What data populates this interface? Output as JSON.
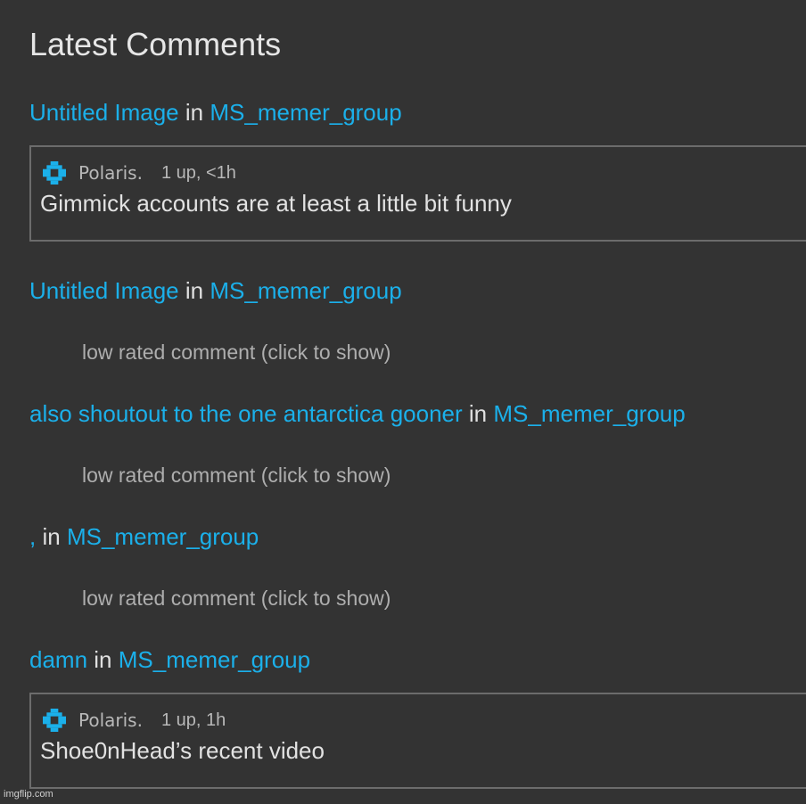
{
  "page": {
    "heading": "Latest Comments",
    "watermark": "imgflip.com"
  },
  "colors": {
    "background": "#333333",
    "link": "#1bb0ea",
    "icon": "#1bb0ea",
    "border": "#6c6c6c"
  },
  "comments": [
    {
      "post_title": "Untitled Image",
      "in_word": "in",
      "stream": "MS_memer_group",
      "username": "Polaris.",
      "meta": "1 up, <1h",
      "text": "Gimmick accounts are at least a little bit funny",
      "user_icon": "blue-pixel-cross-icon"
    },
    {
      "post_title": "Untitled Image",
      "in_word": "in",
      "stream": "MS_memer_group",
      "low_rated_text": "low rated comment (click to show)"
    },
    {
      "post_title": "also shoutout to the one antarctica gooner",
      "in_word": "in",
      "stream": "MS_memer_group",
      "low_rated_text": "low rated comment (click to show)"
    },
    {
      "post_title": ",",
      "in_word": "in",
      "stream": "MS_memer_group",
      "low_rated_text": "low rated comment (click to show)"
    },
    {
      "post_title": "damn",
      "in_word": "in",
      "stream": "MS_memer_group",
      "username": "Polaris.",
      "meta": "1 up, 1h",
      "text": "Shoe0nHead’s recent video",
      "user_icon": "blue-pixel-cross-icon"
    }
  ]
}
